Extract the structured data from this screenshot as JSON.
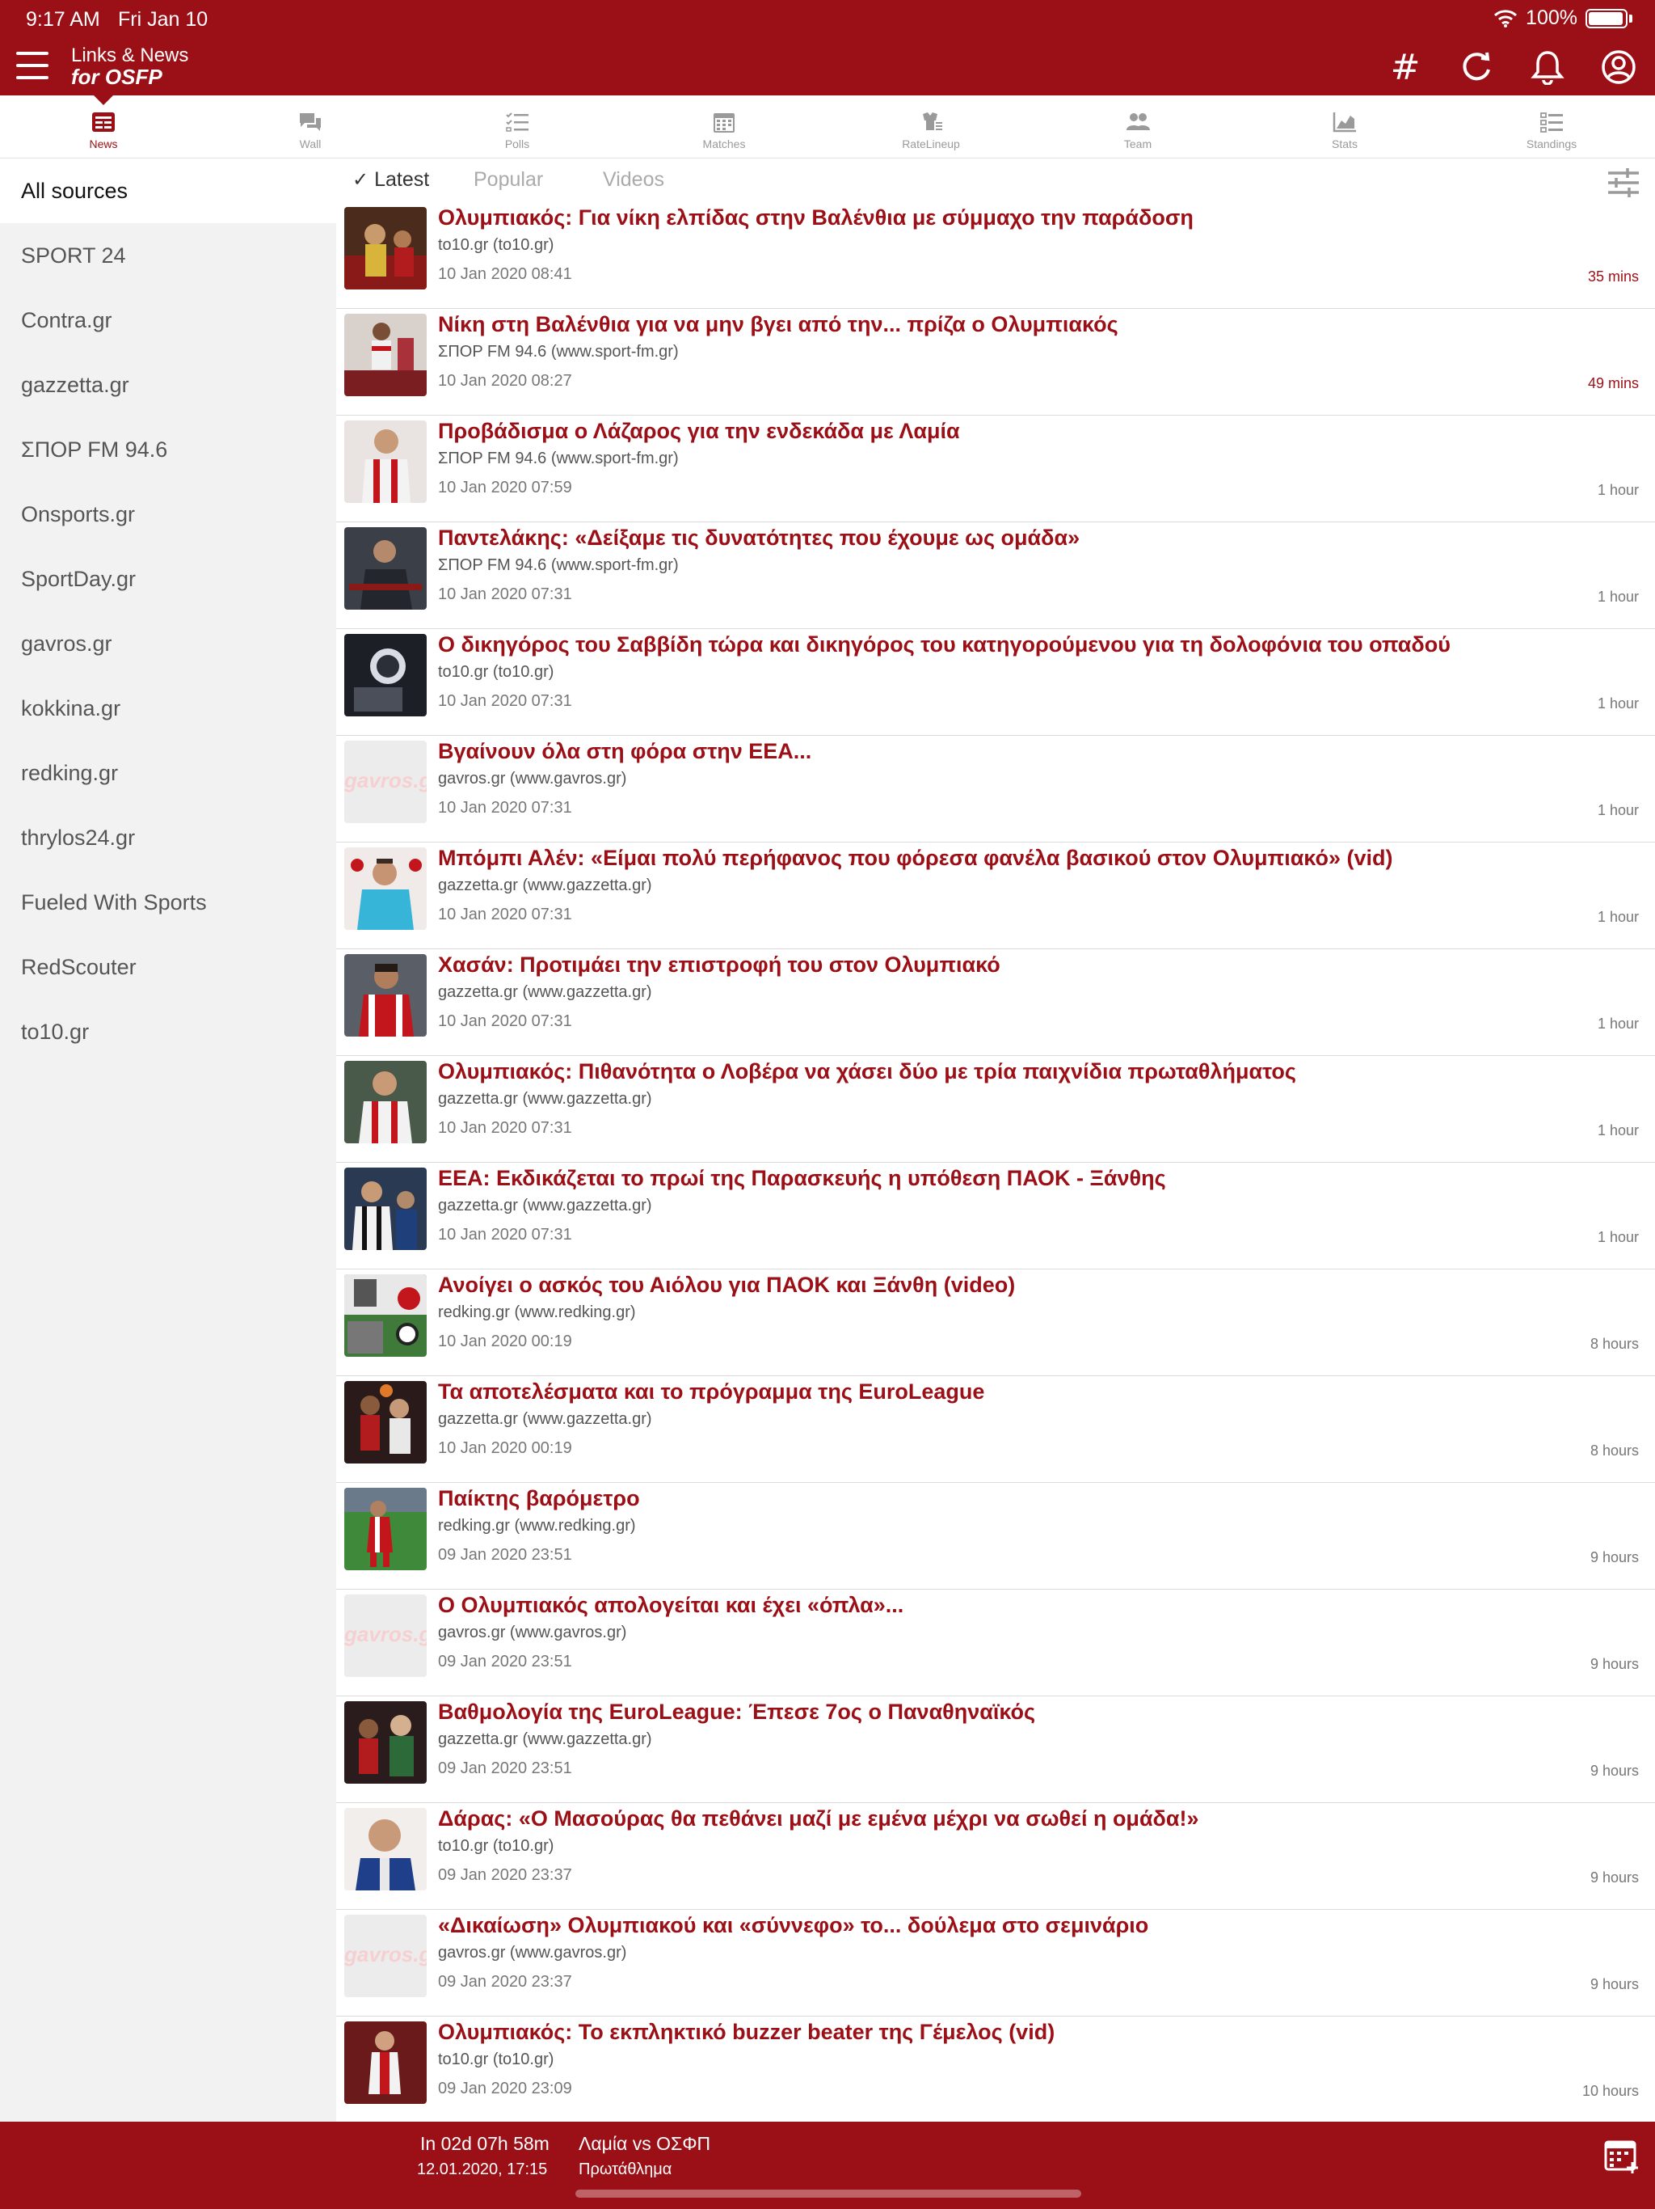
{
  "status": {
    "time": "9:17 AM",
    "date": "Fri Jan 10",
    "battery": "100%"
  },
  "header": {
    "title_line1": "Links & News",
    "title_line2": "for OSFP",
    "hashtag_icon": "#",
    "refresh_icon": "↻"
  },
  "tabs": [
    {
      "label": "News",
      "icon": "news-icon"
    },
    {
      "label": "Wall",
      "icon": "chat-icon"
    },
    {
      "label": "Polls",
      "icon": "polls-icon"
    },
    {
      "label": "Matches",
      "icon": "calendar-icon"
    },
    {
      "label": "RateLineup",
      "icon": "lineup-icon"
    },
    {
      "label": "Team",
      "icon": "team-icon"
    },
    {
      "label": "Stats",
      "icon": "stats-icon"
    },
    {
      "label": "Standings",
      "icon": "standings-icon"
    }
  ],
  "sources": [
    "All sources",
    "SPORT 24",
    "Contra.gr",
    "gazzetta.gr",
    "ΣΠΟΡ FM 94.6",
    "Onsports.gr",
    "SportDay.gr",
    "gavros.gr",
    "kokkina.gr",
    "redking.gr",
    "thrylos24.gr",
    "Fueled With Sports",
    "RedScouter",
    "to10.gr"
  ],
  "filters": {
    "latest": "Latest",
    "popular": "Popular",
    "videos": "Videos",
    "check": "✓"
  },
  "placeholder_watermark": "gavros.gr",
  "news": [
    {
      "title": "Ολυμπιακός: Για νίκη ελπίδας στην Βαλένθια με σύμμαχο την παράδοση",
      "source": "to10.gr (to10.gr)",
      "date": "10 Jan 2020 08:41",
      "ago": "35 mins"
    },
    {
      "title": "Νίκη στη Βαλένθια για να μην βγει από την... πρίζα ο Ολυμπιακός",
      "source": "ΣΠΟΡ FM 94.6 (www.sport-fm.gr)",
      "date": "10 Jan 2020 08:27",
      "ago": "49 mins"
    },
    {
      "title": "Προβάδισμα ο Λάζαρος για την ενδεκάδα με Λαμία",
      "source": "ΣΠΟΡ FM 94.6 (www.sport-fm.gr)",
      "date": "10 Jan 2020 07:59",
      "ago": "1 hour"
    },
    {
      "title": "Παντελάκης: «Δείξαμε τις δυνατότητες που έχουμε ως ομάδα»",
      "source": "ΣΠΟΡ FM 94.6 (www.sport-fm.gr)",
      "date": "10 Jan 2020 07:31",
      "ago": "1 hour"
    },
    {
      "title": "Ο δικηγόρος του Σαββίδη τώρα και δικηγόρος του κατηγορούμενου για τη δολοφόνια του οπαδού",
      "source": "to10.gr (to10.gr)",
      "date": "10 Jan 2020 07:31",
      "ago": "1 hour"
    },
    {
      "title": "Βγαίνουν όλα στη φόρα στην ΕΕΑ...",
      "source": "gavros.gr (www.gavros.gr)",
      "date": "10 Jan 2020 07:31",
      "ago": "1 hour"
    },
    {
      "title": "Μπόμπι Αλέν: «Είμαι πολύ περήφανος που φόρεσα φανέλα βασικού στον Ολυμπιακό» (vid)",
      "source": "gazzetta.gr (www.gazzetta.gr)",
      "date": "10 Jan 2020 07:31",
      "ago": "1 hour"
    },
    {
      "title": "Χασάν: Προτιμάει την επιστροφή του στον Ολυμπιακό",
      "source": "gazzetta.gr (www.gazzetta.gr)",
      "date": "10 Jan 2020 07:31",
      "ago": "1 hour"
    },
    {
      "title": "Ολυμπιακός: Πιθανότητα ο Λοβέρα να χάσει δύο με τρία παιχνίδια πρωταθλήματος",
      "source": "gazzetta.gr (www.gazzetta.gr)",
      "date": "10 Jan 2020 07:31",
      "ago": "1 hour"
    },
    {
      "title": "ΕΕΑ: Εκδικάζεται το πρωί της Παρασκευής η υπόθεση ΠΑΟΚ - Ξάνθης",
      "source": "gazzetta.gr (www.gazzetta.gr)",
      "date": "10 Jan 2020 07:31",
      "ago": "1 hour"
    },
    {
      "title": "Ανοίγει ο ασκός του Αιόλου για ΠΑΟΚ και Ξάνθη (video)",
      "source": "redking.gr (www.redking.gr)",
      "date": "10 Jan 2020 00:19",
      "ago": "8 hours"
    },
    {
      "title": "Τα αποτελέσματα και το πρόγραμμα της EuroLeague",
      "source": "gazzetta.gr (www.gazzetta.gr)",
      "date": "10 Jan 2020 00:19",
      "ago": "8 hours"
    },
    {
      "title": "Παίκτης βαρόμετρο",
      "source": "redking.gr (www.redking.gr)",
      "date": "09 Jan 2020 23:51",
      "ago": "9 hours"
    },
    {
      "title": "Ο Ολυμπιακός απολογείται και έχει «όπλα»...",
      "source": "gavros.gr (www.gavros.gr)",
      "date": "09 Jan 2020 23:51",
      "ago": "9 hours"
    },
    {
      "title": "Βαθμολογία της EuroLeague: Έπεσε 7ος ο Παναθηναϊκός",
      "source": "gazzetta.gr (www.gazzetta.gr)",
      "date": "09 Jan 2020 23:51",
      "ago": "9 hours"
    },
    {
      "title": "Δάρας: «Ο Μασούρας θα πεθάνει μαζί με εμένα μέχρι να σωθεί η ομάδα!»",
      "source": "to10.gr (to10.gr)",
      "date": "09 Jan 2020 23:37",
      "ago": "9 hours"
    },
    {
      "title": "«Δικαίωση» Ολυμπιακού και «σύννεφο» το... δούλεμα στο σεμινάριο",
      "source": "gavros.gr (www.gavros.gr)",
      "date": "09 Jan 2020 23:37",
      "ago": "9 hours"
    },
    {
      "title": "Ολυμπιακός: Το εκπληκτικό buzzer beater της Γέμελος (vid)",
      "source": "to10.gr (to10.gr)",
      "date": "09 Jan 2020 23:09",
      "ago": "10 hours"
    }
  ],
  "next_match": {
    "countdown": "In 02d 07h 58m",
    "datetime": "12.01.2020, 17:15",
    "teams": "Λαμία vs ΟΣΦΠ",
    "competition": "Πρωτάθλημα"
  },
  "colors": {
    "brand": "#9b0f16",
    "sidebar_bg": "#f2f2f2"
  }
}
